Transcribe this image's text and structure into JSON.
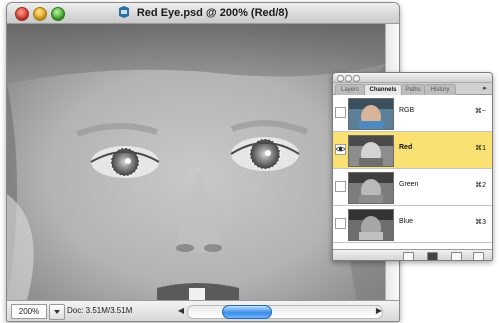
{
  "window": {
    "title": "Red Eye.psd @ 200% (Red/8)",
    "file_icon": "photoshop-file-icon"
  },
  "status_bar": {
    "zoom": "200%",
    "doc_info": "Doc: 3.51M/3.51M",
    "left_arrow": "◀",
    "right_arrow": "▶"
  },
  "palette": {
    "tabs": [
      "Layers",
      "Channels",
      "Paths",
      "History"
    ],
    "active_tab": "Channels",
    "channels": [
      {
        "name": "RGB",
        "shortcut": "⌘~",
        "visible": false,
        "selected": false,
        "thumb_tint": "#7fa9c9"
      },
      {
        "name": "Red",
        "shortcut": "⌘1",
        "visible": true,
        "selected": true,
        "thumb_tint": "#9a9a9a"
      },
      {
        "name": "Green",
        "shortcut": "⌘2",
        "visible": false,
        "selected": false,
        "thumb_tint": "#8a8a8a"
      },
      {
        "name": "Blue",
        "shortcut": "⌘3",
        "visible": false,
        "selected": false,
        "thumb_tint": "#7a7a7a"
      }
    ],
    "footer_icons": [
      "load-selection-icon",
      "save-selection-icon",
      "new-channel-icon",
      "delete-channel-icon"
    ]
  },
  "colors": {
    "selected_row": "#fbe173",
    "scroll_thumb": "#3b8ee8",
    "close": "#d9382a",
    "minimize": "#e0a216",
    "zoom": "#3fa52a"
  }
}
